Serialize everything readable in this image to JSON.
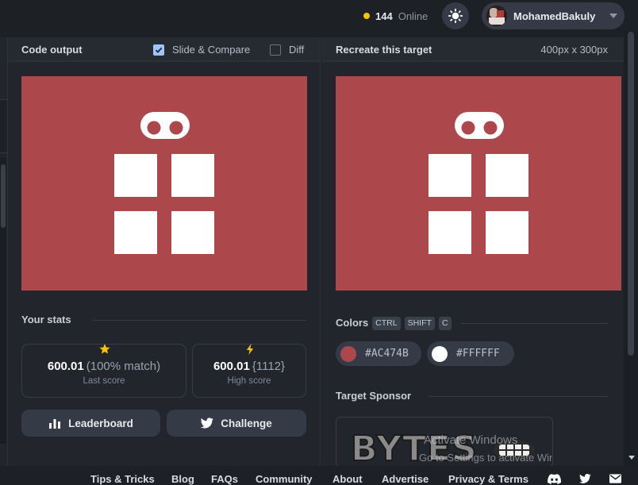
{
  "header": {
    "online_count": "144",
    "online_label": "Online",
    "username": "MohamedBakuly"
  },
  "code_output": {
    "title": "Code output",
    "slide_compare_label": "Slide & Compare",
    "slide_compare_checked": true,
    "diff_label": "Diff",
    "diff_checked": false
  },
  "target": {
    "title": "Recreate this target",
    "dimensions": "400px x 300px"
  },
  "stats": {
    "title": "Your stats",
    "last_score_value": "600.01",
    "last_score_match": "(100% match)",
    "last_score_label": "Last score",
    "high_score_value": "600.01",
    "high_score_rank": "{1112}",
    "high_score_label": "High score"
  },
  "buttons": {
    "leaderboard": "Leaderboard",
    "challenge": "Challenge"
  },
  "colors": {
    "title": "Colors",
    "shortcut_keys": [
      "CTRL",
      "SHIFT",
      "C"
    ],
    "swatches": [
      {
        "hex": "#AC474B",
        "color": "#ac474b"
      },
      {
        "hex": "#FFFFFF",
        "color": "#ffffff"
      }
    ]
  },
  "sponsor": {
    "title": "Target Sponsor",
    "logo_text": "BYTES",
    "watermark_line1": "Activate Windows",
    "watermark_line2": "Go to Settings to activate Windows."
  },
  "footer": {
    "links": [
      "Tips & Tricks",
      "Blog",
      "FAQs",
      "Community",
      "About",
      "Advertise",
      "Privacy & Terms"
    ],
    "icons": [
      "discord-icon",
      "twitter-icon",
      "mail-icon"
    ]
  },
  "theme": {
    "canvas_bg": "#ac474b",
    "shape_color": "#ffffff",
    "page_bg": "#1d2025",
    "panel_bg": "#22262c",
    "button_bg": "#343b47",
    "online_dot": "#f5c400",
    "checkbox_on": "#9ec5ff"
  }
}
